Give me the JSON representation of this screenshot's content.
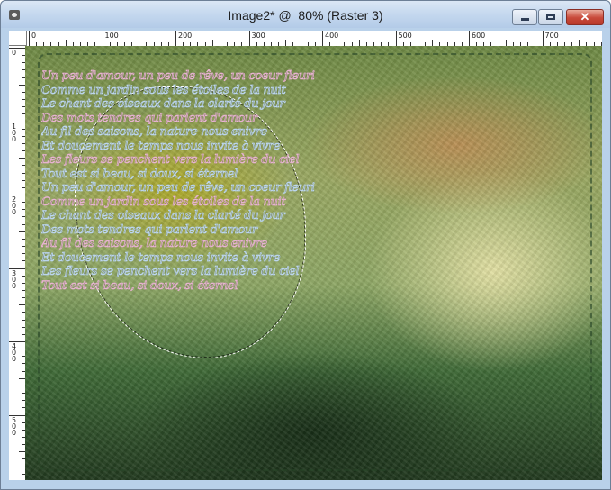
{
  "window": {
    "title": "Image2* @  80% (Raster 3)",
    "controls": {
      "minimize": "minimize-icon",
      "maximize": "maximize-icon",
      "close": "✕"
    }
  },
  "ruler_top": {
    "labels": [
      "0",
      "100",
      "200",
      "300",
      "400",
      "500",
      "600",
      "700"
    ]
  },
  "ruler_left": {
    "labels": [
      "0",
      "1\n0\n0",
      "2\n0\n0",
      "3\n0\n0",
      "4\n0\n0",
      "5\n0\n0"
    ]
  },
  "canvas": {
    "description_icon": "image-layer",
    "script_lines": [
      "Un peu d'amour, un peu de rêve, un coeur fleuri",
      "Comme un jardin sous les étoiles de la nuit",
      "Le chant des oiseaux dans la clarté du jour",
      "Des mots tendres qui parlent d'amour",
      "Au fil des saisons, la nature nous enivre",
      "Et doucement le temps nous invite à vivre",
      "Les fleurs se penchent vers la lumière du ciel",
      "Tout est si beau, si doux, si éternel",
      "Un peu d'amour, un peu de rêve, un coeur fleuri",
      "Comme un jardin sous les étoiles de la nuit",
      "Le chant des oiseaux dans la clarté du jour",
      "Des mots tendres qui parlent d'amour",
      "Au fil des saisons, la nature nous enivre",
      "Et doucement le temps nous invite à vivre",
      "Les fleurs se penchent vers la lumière du ciel",
      "Tout est si beau, si doux, si éternel"
    ]
  }
}
